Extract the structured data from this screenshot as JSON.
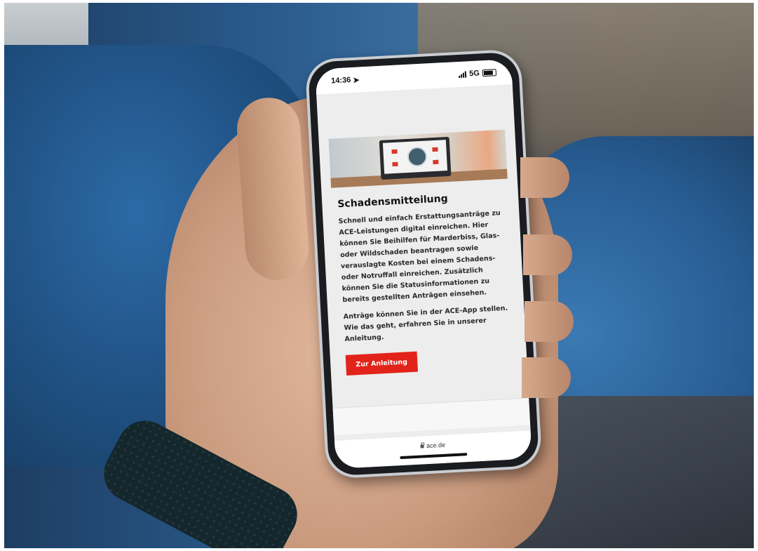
{
  "status_bar": {
    "time": "14:36",
    "network": "5G"
  },
  "article": {
    "title": "Schadensmitteilung",
    "paragraph_1": "Schnell und einfach Erstattungsanträge zu ACE-Leistungen digital einreichen. Hier können Sie Beihilfen für Marderbiss, Glas- oder Wildschaden beantragen sowie verauslagte Kosten bei einem Schadens- oder Notruffall einreichen. Zusätzlich können Sie die Statusinformationen zu bereits gestellten Anträgen einsehen.",
    "paragraph_2": "Anträge können Sie in der ACE-App stellen. Wie das geht, erfahren Sie in unserer Anleitung.",
    "cta_label": "Zur Anleitung"
  },
  "browser": {
    "url": "ace.de"
  },
  "colors": {
    "accent": "#e2231a",
    "page_background": "#ededed"
  },
  "icons": {
    "location": "location-arrow-icon",
    "signal": "cellular-signal-icon",
    "battery": "battery-icon",
    "lock": "lock-icon"
  }
}
